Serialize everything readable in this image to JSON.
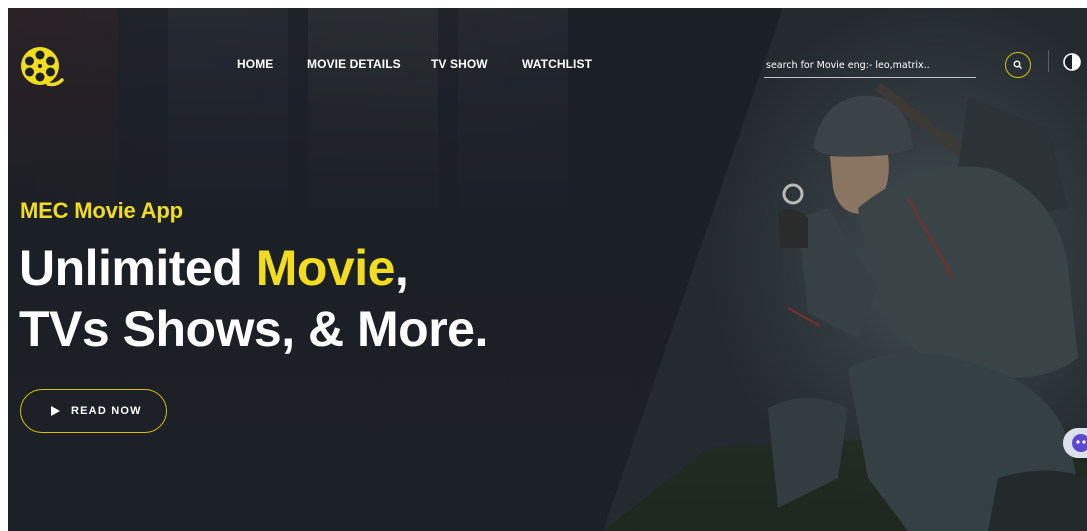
{
  "nav": {
    "logo_icon": "film-reel-icon",
    "items": [
      {
        "label": "HOME"
      },
      {
        "label": "MOVIE DETAILS"
      },
      {
        "label": "TV SHOW"
      },
      {
        "label": "WATCHLIST"
      }
    ]
  },
  "search": {
    "placeholder": "search for Movie eng:- leo,matrix..",
    "button_icon": "search-icon"
  },
  "theme_toggle_icon": "contrast-icon",
  "hero": {
    "subtitle": "MEC Movie App",
    "headline_part1": "Unlimited ",
    "headline_accent": "Movie",
    "headline_part2": ",",
    "headline_line2": "TVs Shows, & More.",
    "cta_label": "READ NOW",
    "cta_icon": "play-icon"
  },
  "colors": {
    "accent": "#f1dc1f",
    "background": "#1b1f26",
    "text": "#ffffff"
  },
  "chat_widget_icon": "chat-icon"
}
